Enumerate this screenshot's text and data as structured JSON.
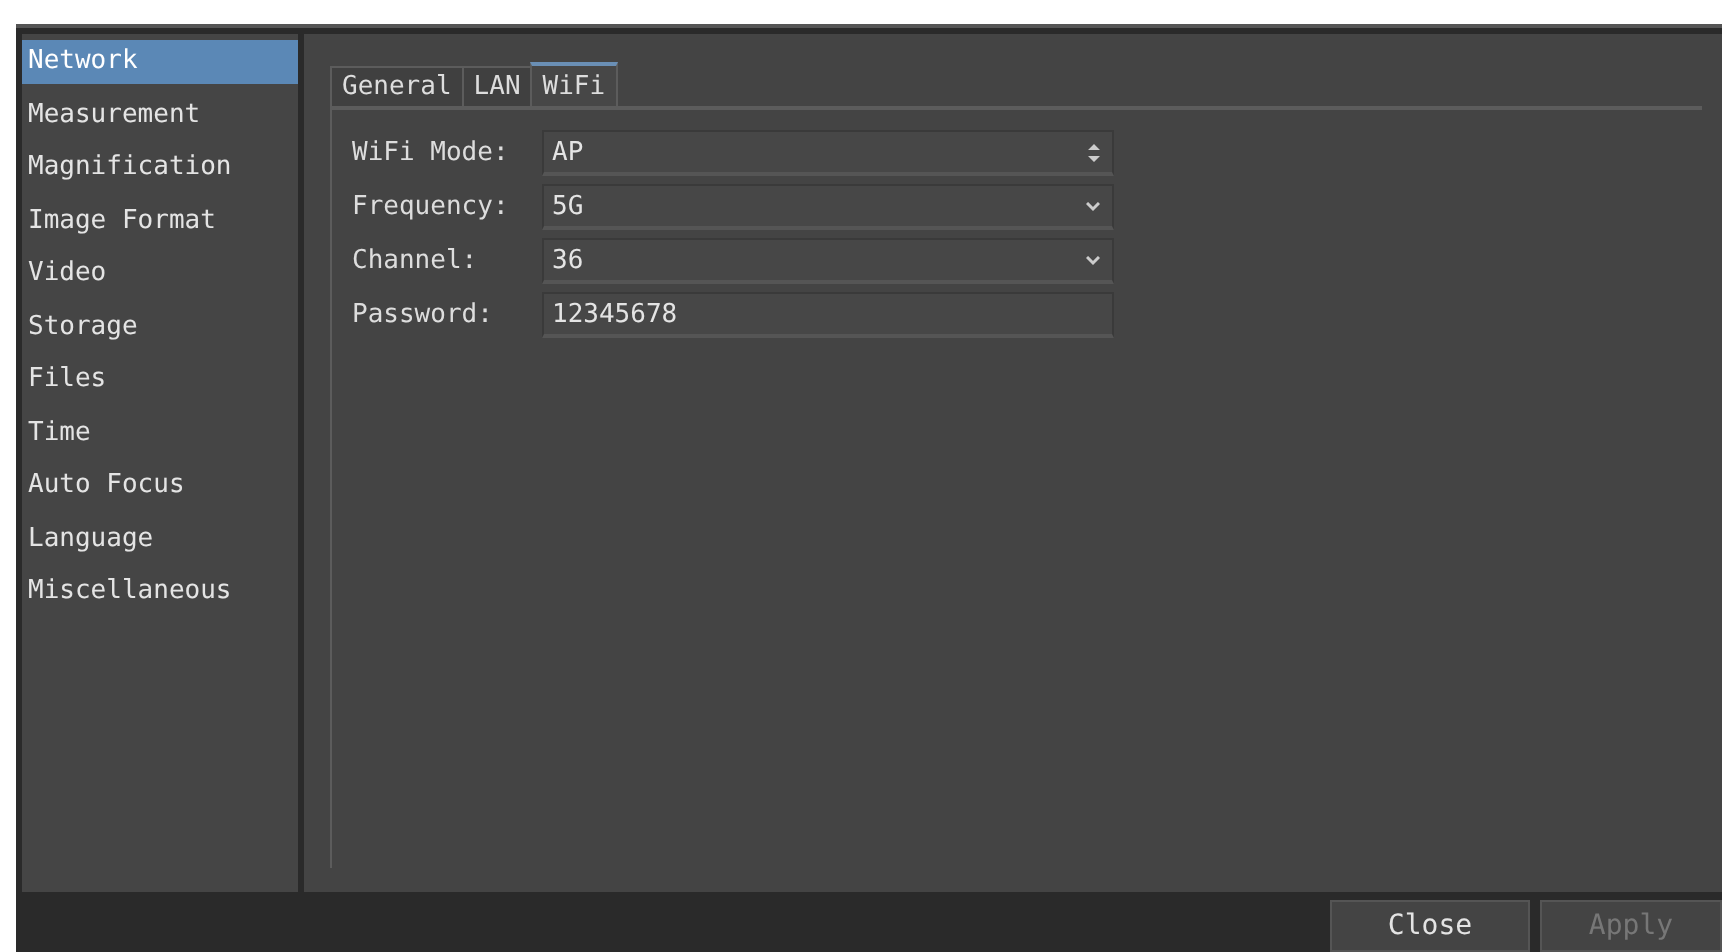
{
  "sidebar": {
    "items": [
      {
        "label": "Network",
        "selected": true
      },
      {
        "label": "Measurement",
        "selected": false
      },
      {
        "label": "Magnification",
        "selected": false
      },
      {
        "label": "Image Format",
        "selected": false
      },
      {
        "label": "Video",
        "selected": false
      },
      {
        "label": "Storage",
        "selected": false
      },
      {
        "label": "Files",
        "selected": false
      },
      {
        "label": "Time",
        "selected": false
      },
      {
        "label": "Auto Focus",
        "selected": false
      },
      {
        "label": "Language",
        "selected": false
      },
      {
        "label": "Miscellaneous",
        "selected": false
      }
    ]
  },
  "tabs": [
    {
      "label": "General",
      "selected": false
    },
    {
      "label": "LAN",
      "selected": false
    },
    {
      "label": "WiFi",
      "selected": true
    }
  ],
  "fields": [
    {
      "label": "WiFi Mode:",
      "value": "AP",
      "kind": "spin"
    },
    {
      "label": "Frequency:",
      "value": "5G",
      "kind": "combo"
    },
    {
      "label": "Channel:",
      "value": "36",
      "kind": "combo"
    },
    {
      "label": "Password:",
      "value": "12345678",
      "kind": "text"
    }
  ],
  "buttons": [
    {
      "label": "Close",
      "disabled": false
    },
    {
      "label": "Apply",
      "disabled": true
    }
  ]
}
